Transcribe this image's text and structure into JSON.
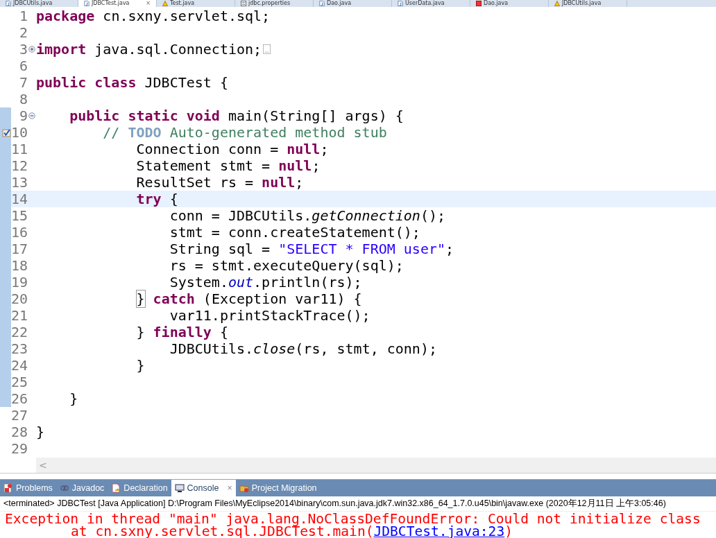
{
  "editor_tabs": [
    {
      "label": "JDBCUtils.java",
      "kind": "java",
      "selected": false
    },
    {
      "label": "JDBCTest.java",
      "kind": "java",
      "selected": true,
      "close": "×"
    },
    {
      "label": "Test.java",
      "kind": "java-warning",
      "selected": false
    },
    {
      "label": "jdbc.properties",
      "kind": "properties",
      "selected": false
    },
    {
      "label": "Dao.java",
      "kind": "java",
      "selected": false
    },
    {
      "label": "UserData.java",
      "kind": "java",
      "selected": false
    },
    {
      "label": "Dao.java",
      "kind": "java-error",
      "selected": false
    },
    {
      "label": "JDBCUtils.java",
      "kind": "java-warning",
      "selected": false
    }
  ],
  "code_lines": [
    {
      "number": "1",
      "current": false,
      "in_scope": false,
      "task": false,
      "tokens": [
        {
          "kind": "keyword",
          "text": "package"
        },
        {
          "kind": "plain",
          "text": " cn.sxny.servlet.sql;"
        }
      ]
    },
    {
      "number": "2",
      "current": false,
      "in_scope": false,
      "task": false
    },
    {
      "number": "3",
      "folded": true,
      "current": false,
      "in_scope": false,
      "task": false,
      "tokens": [
        {
          "kind": "keyword",
          "text": "import"
        },
        {
          "kind": "plain",
          "text": " java.sql.Connection;"
        }
      ]
    },
    {
      "number": "6",
      "current": false,
      "in_scope": false,
      "task": false
    },
    {
      "number": "7",
      "current": false,
      "in_scope": false,
      "task": false,
      "tokens": [
        {
          "kind": "keyword",
          "text": "public class"
        },
        {
          "kind": "plain",
          "text": " JDBCTest {"
        }
      ]
    },
    {
      "number": "8",
      "current": false,
      "in_scope": false,
      "task": false
    },
    {
      "number": "9",
      "folded": false,
      "current": false,
      "in_scope": true,
      "task": false,
      "tokens": [
        {
          "kind": "keyword",
          "text": "    public static void"
        },
        {
          "kind": "plain",
          "text": " main(String[] args) {"
        }
      ]
    },
    {
      "number": "10",
      "current": false,
      "in_scope": true,
      "task": true,
      "tokens": [
        {
          "kind": "comment",
          "text": "        // "
        },
        {
          "kind": "todo",
          "text": "TODO"
        },
        {
          "kind": "comment",
          "text": " Auto-generated method stub"
        }
      ]
    },
    {
      "number": "11",
      "current": false,
      "in_scope": true,
      "task": false,
      "tokens": [
        {
          "kind": "plain",
          "text": "            Connection conn = "
        },
        {
          "kind": "keyword",
          "text": "null"
        },
        {
          "kind": "plain",
          "text": ";"
        }
      ]
    },
    {
      "number": "12",
      "current": false,
      "in_scope": true,
      "task": false,
      "tokens": [
        {
          "kind": "plain",
          "text": "            Statement stmt = "
        },
        {
          "kind": "keyword",
          "text": "null"
        },
        {
          "kind": "plain",
          "text": ";"
        }
      ]
    },
    {
      "number": "13",
      "current": false,
      "in_scope": true,
      "task": false,
      "tokens": [
        {
          "kind": "plain",
          "text": "            ResultSet rs = "
        },
        {
          "kind": "keyword",
          "text": "null"
        },
        {
          "kind": "plain",
          "text": ";"
        }
      ]
    },
    {
      "number": "14",
      "current": true,
      "in_scope": true,
      "task": false,
      "tokens": [
        {
          "kind": "keyword",
          "text": "            try"
        },
        {
          "kind": "plain",
          "text": " {"
        }
      ]
    },
    {
      "number": "15",
      "current": false,
      "in_scope": true,
      "task": false,
      "tokens": [
        {
          "kind": "plain",
          "text": "                conn = JDBCUtils."
        },
        {
          "kind": "static-method",
          "text": "getConnection"
        },
        {
          "kind": "plain",
          "text": "();"
        }
      ]
    },
    {
      "number": "16",
      "current": false,
      "in_scope": true,
      "task": false,
      "tokens": [
        {
          "kind": "plain",
          "text": "                stmt = conn.createStatement();"
        }
      ]
    },
    {
      "number": "17",
      "current": false,
      "in_scope": true,
      "task": false,
      "tokens": [
        {
          "kind": "plain",
          "text": "                String sql = "
        },
        {
          "kind": "string",
          "text": "\"SELECT * FROM user\""
        },
        {
          "kind": "plain",
          "text": ";"
        }
      ]
    },
    {
      "number": "18",
      "current": false,
      "in_scope": true,
      "task": false,
      "tokens": [
        {
          "kind": "plain",
          "text": "                rs = stmt.executeQuery(sql);"
        }
      ]
    },
    {
      "number": "19",
      "current": false,
      "in_scope": true,
      "task": false,
      "tokens": [
        {
          "kind": "plain",
          "text": "                System."
        },
        {
          "kind": "static-field",
          "text": "out"
        },
        {
          "kind": "plain",
          "text": ".println(rs);"
        }
      ]
    },
    {
      "number": "20",
      "current": false,
      "in_scope": true,
      "task": false,
      "tokens": [
        {
          "kind": "bracket-match",
          "text": "            }"
        },
        {
          "kind": "keyword",
          "text": " catch"
        },
        {
          "kind": "plain",
          "text": " (Exception var11) {"
        }
      ]
    },
    {
      "number": "21",
      "current": false,
      "in_scope": true,
      "task": false,
      "tokens": [
        {
          "kind": "plain",
          "text": "                var11.printStackTrace();"
        }
      ]
    },
    {
      "number": "22",
      "current": false,
      "in_scope": true,
      "task": false,
      "tokens": [
        {
          "kind": "plain",
          "text": "            } "
        },
        {
          "kind": "keyword",
          "text": "finally"
        },
        {
          "kind": "plain",
          "text": " {"
        }
      ]
    },
    {
      "number": "23",
      "current": false,
      "in_scope": true,
      "task": false,
      "tokens": [
        {
          "kind": "plain",
          "text": "                JDBCUtils."
        },
        {
          "kind": "static-method",
          "text": "close"
        },
        {
          "kind": "plain",
          "text": "(rs, stmt, conn);"
        }
      ]
    },
    {
      "number": "24",
      "current": false,
      "in_scope": true,
      "task": false,
      "tokens": [
        {
          "kind": "plain",
          "text": "            }"
        }
      ]
    },
    {
      "number": "25",
      "current": false,
      "in_scope": true,
      "task": false
    },
    {
      "number": "26",
      "current": false,
      "in_scope": true,
      "task": false,
      "tokens": [
        {
          "kind": "plain",
          "text": "    }"
        }
      ]
    },
    {
      "number": "27",
      "current": false,
      "in_scope": false,
      "task": false
    },
    {
      "number": "28",
      "current": false,
      "in_scope": false,
      "task": false,
      "tokens": [
        {
          "kind": "plain",
          "text": "}"
        }
      ]
    },
    {
      "number": "29",
      "current": false,
      "in_scope": false,
      "task": false
    }
  ],
  "scrollbar": {
    "arrow": "<"
  },
  "panel_tabs": [
    {
      "label": "Problems",
      "kind": "problems",
      "selected": false
    },
    {
      "label": "Javadoc",
      "kind": "javadoc",
      "selected": false
    },
    {
      "label": "Declaration",
      "kind": "declaration",
      "selected": false
    },
    {
      "label": "Console",
      "kind": "console",
      "selected": true,
      "close": "×"
    },
    {
      "label": "Project Migration",
      "kind": "migration",
      "selected": false
    }
  ],
  "console": {
    "header": "<terminated> JDBCTest [Java Application] D:\\Program Files\\MyEclipse2014\\binary\\com.sun.java.jdk7.win32.x86_64_1.7.0.u45\\bin\\javaw.exe (2020年12月11日 上午3:05:46)",
    "lines": [
      {
        "kind": "error",
        "text": "Exception in thread \"main\" java.lang.NoClassDefFoundError: Could not initialize class"
      },
      {
        "kind": "trace",
        "text": "at cn.sxny.servlet.sql.JDBCTest.main(",
        "link": "JDBCTest.java:23",
        "after": ")"
      }
    ]
  }
}
